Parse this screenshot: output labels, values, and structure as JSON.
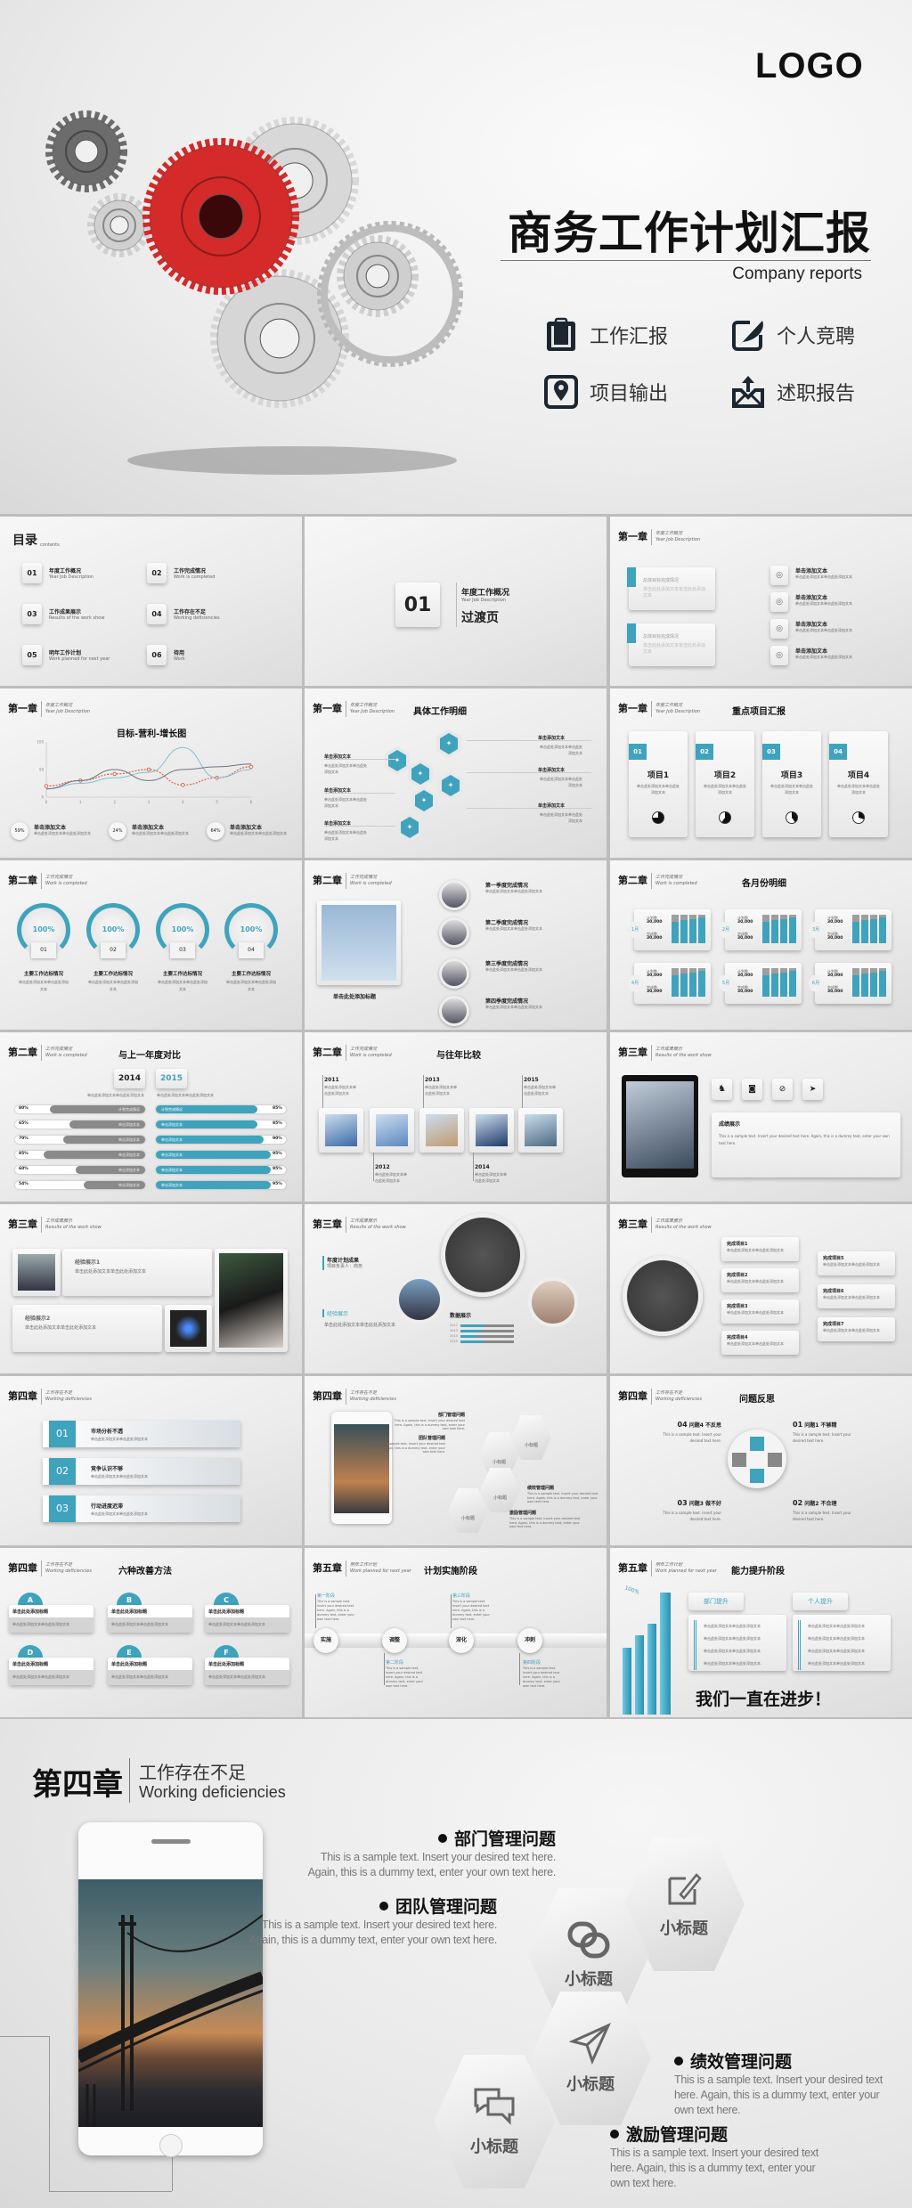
{
  "cover": {
    "logo": "LOGO",
    "title": "商务工作计划汇报",
    "subtitle": "Company reports",
    "items": [
      {
        "label": "工作汇报",
        "icon": "clipboard-icon"
      },
      {
        "label": "个人竞聘",
        "icon": "edit-feather-icon"
      },
      {
        "label": "项目输出",
        "icon": "location-pin-icon"
      },
      {
        "label": "述职报告",
        "icon": "mail-upload-icon"
      }
    ],
    "accent": "#d42a2a"
  },
  "colors": {
    "accent": "#3fa3bd",
    "dark": "#111111",
    "gray": "#8a8a8a"
  },
  "ph": {
    "short": "单击添加文本",
    "line": "单击此处添加文本单击此处添加文本",
    "title": "单击此处添加标题",
    "en": "This is a sample text. Insert your desired text here. Again, this is a dummy text, enter your own text here."
  },
  "s1": {
    "title": "目录",
    "sub": "contents",
    "items": [
      {
        "num": "01",
        "cn": "年度工作概况",
        "en": "Year Job Description"
      },
      {
        "num": "02",
        "cn": "工作完成情况",
        "en": "Work is completed"
      },
      {
        "num": "03",
        "cn": "工作成果展示",
        "en": "Results of the work show"
      },
      {
        "num": "04",
        "cn": "工作存在不足",
        "en": "Working deficiencies"
      },
      {
        "num": "05",
        "cn": "明年工作计划",
        "en": "Work planned for next year"
      },
      {
        "num": "06",
        "cn": "待用",
        "en": "Work"
      }
    ]
  },
  "s2": {
    "num": "01",
    "cn": "年度工作概况",
    "en": "Year Job Description",
    "label": "过渡页"
  },
  "ch1": {
    "chapter": "第一章",
    "cn": "年度工作概况",
    "en": "Year Job Description"
  },
  "ch2": {
    "chapter": "第二章",
    "cn": "工作完成情况",
    "en": "Work is completed"
  },
  "ch3": {
    "chapter": "第三章",
    "cn": "工作成果展示",
    "en": "Results of the work show"
  },
  "ch4": {
    "chapter": "第四章",
    "cn": "工作存在不足",
    "en": "Working deficiencies"
  },
  "ch5": {
    "chapter": "第五章",
    "cn": "明年工作计划",
    "en": "Work planned for next year"
  },
  "s3": {
    "card": "总体目标完成情况"
  },
  "s4": {
    "title": "目标-营利-增长图",
    "stats": [
      "59%",
      "24%",
      "64%"
    ],
    "chart": {
      "type": "line",
      "x": [
        0,
        1,
        2,
        3,
        4,
        5,
        6
      ],
      "xticks": [
        "0",
        "1",
        "2",
        "3",
        "4",
        "5",
        "6"
      ],
      "yticks": [
        "0",
        "50",
        "100"
      ],
      "ylim": [
        0,
        100
      ],
      "series": [
        {
          "color": "#e0604a",
          "values": [
            20,
            30,
            42,
            50,
            22,
            35,
            55
          ]
        },
        {
          "color": "#7fc3cf",
          "values": [
            15,
            25,
            35,
            45,
            90,
            35,
            50
          ]
        },
        {
          "color": "#6d7480",
          "values": [
            15,
            30,
            50,
            30,
            50,
            55,
            60
          ]
        }
      ]
    }
  },
  "s5": {
    "title": "具体工作明细"
  },
  "s6": {
    "title": "重点项目汇报",
    "items": [
      {
        "num": "01",
        "label": "项目1",
        "pie": 0.75
      },
      {
        "num": "02",
        "label": "项目2",
        "pie": 0.6
      },
      {
        "num": "03",
        "label": "项目3",
        "pie": 0.4
      },
      {
        "num": "04",
        "label": "项目4",
        "pie": 0.3
      }
    ]
  },
  "s7": {
    "items": [
      {
        "pct": "100%",
        "num": "01"
      },
      {
        "pct": "100%",
        "num": "02"
      },
      {
        "pct": "100%",
        "num": "03"
      },
      {
        "pct": "100%",
        "num": "04"
      }
    ],
    "label": "主要工作达标情况"
  },
  "s8": {
    "caption": "单击此处添加标题",
    "items": [
      "第一季度完成情况",
      "第二季度完成情况",
      "第三季度完成情况",
      "第四季度完成情况"
    ]
  },
  "s9": {
    "title": "各月份明细",
    "plan": "计划数",
    "done": "完成数",
    "value": "30,000",
    "months": [
      "1月",
      "2月",
      "3月",
      "4月",
      "5月",
      "6月"
    ]
  },
  "s10": {
    "title": "与上一年度对比",
    "y1": "2014",
    "y2": "2015",
    "first": "计划完成情况",
    "left": [
      80,
      65,
      70,
      85,
      60,
      54
    ],
    "right": [
      85,
      85,
      90,
      95,
      95,
      95
    ]
  },
  "s11": {
    "title": "与往年比较",
    "years": [
      "2011",
      "2012",
      "2013",
      "2014",
      "2015"
    ]
  },
  "s12": {
    "box": "成绩展示"
  },
  "s13": {
    "a": "经验展示1",
    "b": "经验展示2"
  },
  "s14": {
    "a": "年度计划成果",
    "a2": "项目负责人：商务",
    "b": "经验展示",
    "c": "数据展示",
    "years": [
      "2012",
      "2013",
      "2014",
      "2015"
    ],
    "bars": [
      45,
      40,
      30,
      45
    ]
  },
  "s15": {
    "items": [
      "完成项目1",
      "完成项目2",
      "完成项目3",
      "完成项目4",
      "完成项目5",
      "完成项目6",
      "完成项目7"
    ]
  },
  "s16": {
    "items": [
      {
        "num": "01",
        "label": "市场分析不透"
      },
      {
        "num": "02",
        "label": "竞争认识不够"
      },
      {
        "num": "03",
        "label": "行动进度迟滞"
      }
    ]
  },
  "s18": {
    "title": "问题反思",
    "items": [
      {
        "num": "01",
        "label": "问题1 不够精"
      },
      {
        "num": "02",
        "label": "问题2 不合理"
      },
      {
        "num": "03",
        "label": "问题3 做不好"
      },
      {
        "num": "04",
        "label": "问题4 不反思"
      }
    ],
    "sample": "This is a sample text. Insert your desired text here."
  },
  "s19": {
    "title": "六种改善方法",
    "letters": [
      "A",
      "B",
      "C",
      "D",
      "E",
      "F"
    ]
  },
  "s20": {
    "title": "计划实施阶段",
    "nodes": [
      "实施",
      "调整",
      "深化",
      "冲刺"
    ],
    "stages": [
      "第一阶段",
      "第二阶段",
      "第三阶段",
      "第四阶段"
    ]
  },
  "s21": {
    "title": "能力提升阶段",
    "a": "部门提升",
    "b": "个人提升",
    "pct": "100%",
    "slogan": "我们一直在进步！"
  },
  "feature": {
    "chapter": "第四章",
    "cn": "工作存在不足",
    "en": "Working deficiencies",
    "items": [
      {
        "title": "部门管理问题",
        "text": "This is a sample text. Insert your desired text here. Again, this is a dummy text, enter your own text here."
      },
      {
        "title": "团队管理问题",
        "text": "This is a sample text. Insert your desired text here. Again, this is a dummy text, enter your own text here."
      },
      {
        "title": "绩效管理问题",
        "text": "This is a sample text. Insert your desired text here. Again, this is a dummy text, enter your own text here."
      },
      {
        "title": "激励管理问题",
        "text": "This is a sample text. Insert your desired text here. Again, this is a dummy text, enter your own text here."
      }
    ],
    "hex": [
      {
        "label": "小标题",
        "icon": "edit-icon"
      },
      {
        "label": "小标题",
        "icon": "link-icon"
      },
      {
        "label": "小标题",
        "icon": "paper-plane-icon"
      },
      {
        "label": "小标题",
        "icon": "chat-bubbles-icon"
      }
    ]
  }
}
